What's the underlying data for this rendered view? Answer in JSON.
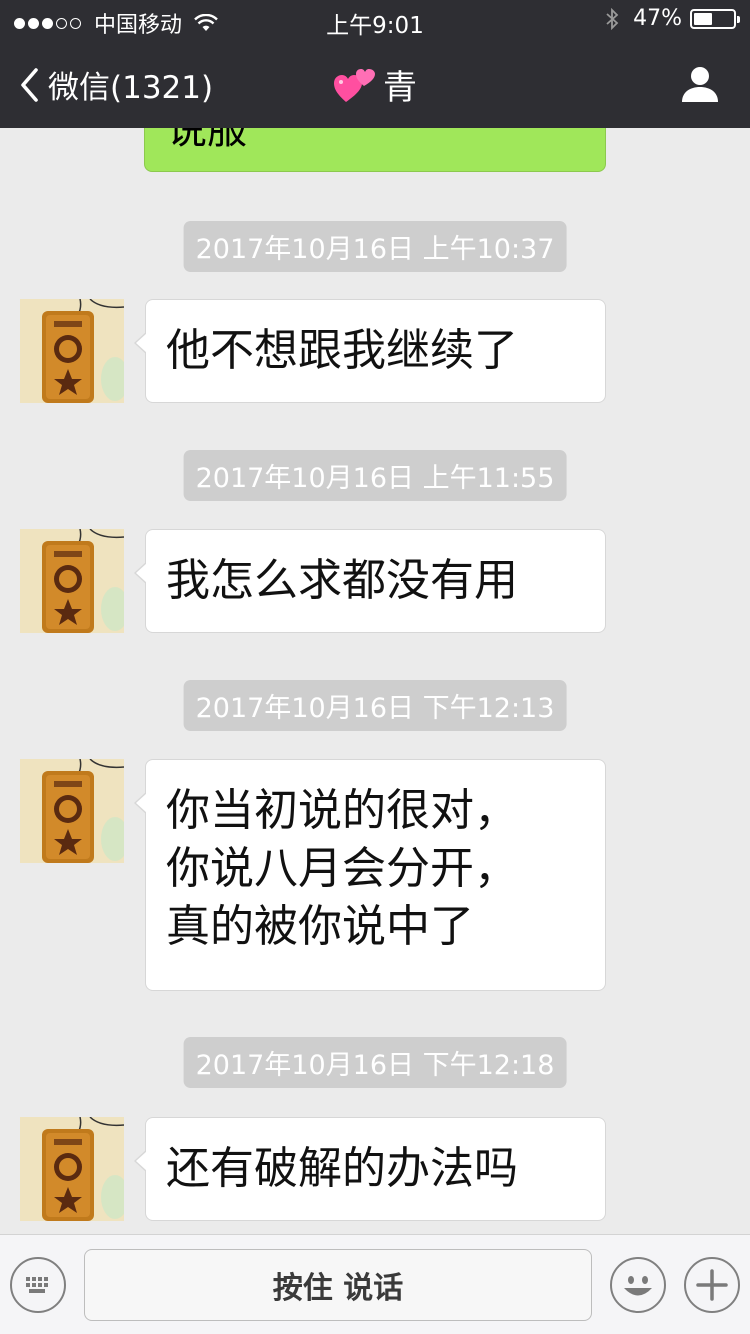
{
  "status_bar": {
    "carrier": "中国移动",
    "time": "上午9:01",
    "battery_percent_text": "47%",
    "battery_level": 0.47
  },
  "nav": {
    "back_label": "微信(1321)",
    "contact_name": "青"
  },
  "chat": {
    "top_partial_sent_message": "说服",
    "messages": [
      {
        "timestamp": "2017年10月16日 上午10:37",
        "lines": [
          "他不想跟我继续了"
        ]
      },
      {
        "timestamp": "2017年10月16日 上午11:55",
        "lines": [
          "我怎么求都没有用"
        ]
      },
      {
        "timestamp": "2017年10月16日 下午12:13",
        "lines": [
          "你当初说的很对，",
          "你说八月会分开，",
          "真的被你说中了"
        ]
      },
      {
        "timestamp": "2017年10月16日 下午12:18",
        "lines": [
          "还有破解的办法吗"
        ]
      }
    ]
  },
  "input_bar": {
    "hold_to_talk_label": "按住 说话"
  },
  "colors": {
    "header_bg": "#2e2e33",
    "chat_bg": "#ebebeb",
    "sent_bubble": "#a0e75a",
    "timestamp_bg": "#cecece"
  },
  "icons": [
    "wifi-icon",
    "bluetooth-icon",
    "battery-icon",
    "back-chevron-icon",
    "hearts-emoji-icon",
    "profile-icon",
    "keyboard-icon",
    "emoji-icon",
    "plus-icon"
  ]
}
